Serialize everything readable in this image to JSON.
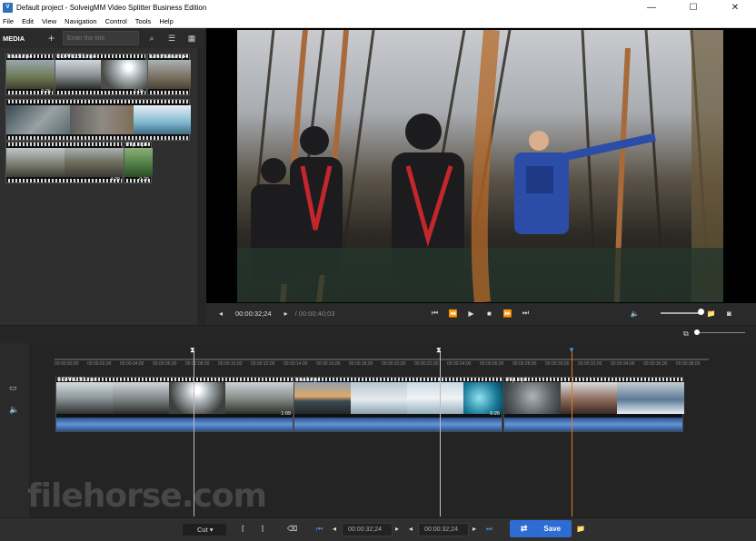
{
  "window": {
    "title": "Default project - SolveigMM Video Splitter Business Edition",
    "min": "—",
    "max": "☐",
    "close": "✕"
  },
  "menu": [
    "File",
    "Edit",
    "View",
    "Navigation",
    "Control",
    "Tools",
    "Help"
  ],
  "media": {
    "label": "MEDIA",
    "add": "+",
    "search_placeholder": "Enter the title",
    "clips": [
      {
        "name": "brasil.mp4",
        "dur": "0:26"
      },
      {
        "name": "GOPR1150.mp4",
        "dur": "1:09"
      },
      {
        "name": "kamchatka.mp4",
        "dur": ""
      },
      {
        "name": "",
        "dur": ""
      },
      {
        "name": "",
        "dur": "4:20"
      },
      {
        "name": "ship.mp4",
        "dur": "0:20"
      }
    ]
  },
  "player": {
    "current": "00:00:32;24",
    "total": "/ 00:00:40;03"
  },
  "timeline": {
    "ticks": [
      "00:00:00;00",
      "00:00:02;00",
      "00:00:04;00",
      "00:00:06;00",
      "00:00:08;00",
      "00:00:10;00",
      "00:00:12;00",
      "00:00:14;00",
      "00:00:16;00",
      "00:00:18;00",
      "00:00:20;00",
      "00:00:22;00",
      "00:00:24;00",
      "00:00:26;00",
      "00:00:28;00",
      "00:00:30;00",
      "00:00:32;00",
      "00:00:34;00",
      "00:00:36;00",
      "00:00:38;00",
      "00:00:40;00"
    ],
    "tracks": [
      {
        "name": "GOPR1150.mp4",
        "dur": "1:09"
      },
      {
        "name": "brasil.mp4",
        "dur": "0:26"
      },
      {
        "name": "ship.mp4",
        "dur": ""
      }
    ]
  },
  "bottom": {
    "mode": "Cut",
    "tc1": "00:00:32;24",
    "tc2": "00:00:32;24",
    "save": "Save"
  },
  "watermark": "filehorse.com"
}
